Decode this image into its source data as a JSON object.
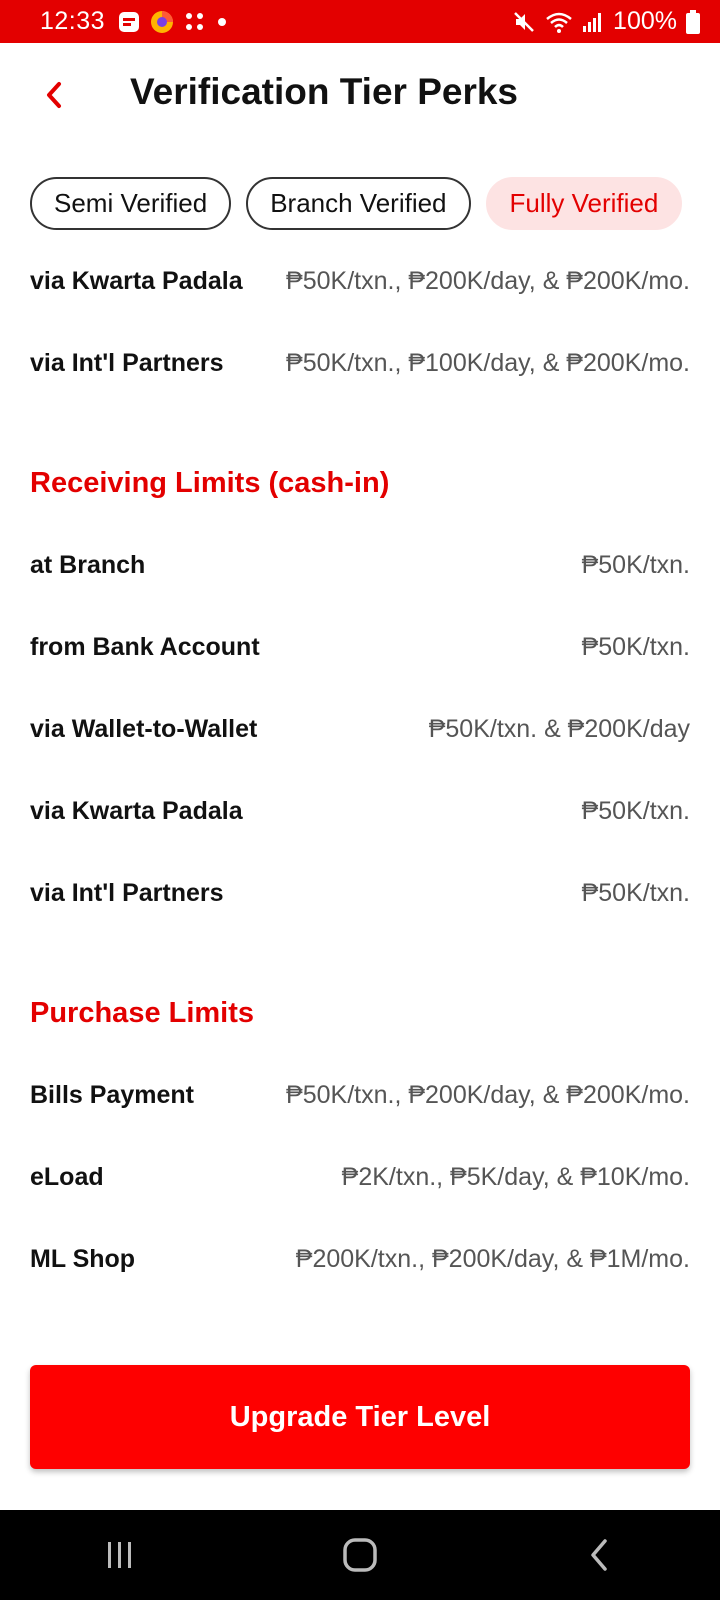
{
  "status_bar": {
    "time": "12:33",
    "battery": "100%",
    "icons": [
      "app-icon",
      "browser-icon",
      "dots-app-icon",
      "dot-icon",
      "mute-icon",
      "wifi-icon",
      "signal-icon",
      "battery-icon"
    ]
  },
  "header": {
    "title": "Verification Tier Perks",
    "back_icon": "chevron-left-icon"
  },
  "tabs": [
    {
      "label": "Semi Verified",
      "active": false
    },
    {
      "label": "Branch Verified",
      "active": false
    },
    {
      "label": "Fully Verified",
      "active": true
    }
  ],
  "sending_rows": [
    {
      "label": "via Kwarta Padala",
      "value": "₱50K/txn., ₱200K/day, & ₱200K/mo."
    },
    {
      "label": "via Int'l Partners",
      "value": "₱50K/txn., ₱100K/day, & ₱200K/mo."
    }
  ],
  "receiving": {
    "title": "Receiving Limits (cash-in)",
    "rows": [
      {
        "label": "at Branch",
        "value": "₱50K/txn."
      },
      {
        "label": "from Bank Account",
        "value": "₱50K/txn."
      },
      {
        "label": "via Wallet-to-Wallet",
        "value": "₱50K/txn. & ₱200K/day"
      },
      {
        "label": "via Kwarta Padala",
        "value": "₱50K/txn."
      },
      {
        "label": "via Int'l Partners",
        "value": "₱50K/txn."
      }
    ]
  },
  "purchase": {
    "title": "Purchase Limits",
    "rows": [
      {
        "label": "Bills Payment",
        "value": "₱50K/txn., ₱200K/day, & ₱200K/mo."
      },
      {
        "label": "eLoad",
        "value": "₱2K/txn., ₱5K/day, & ₱10K/mo."
      },
      {
        "label": "ML Shop",
        "value": "₱200K/txn., ₱200K/day, & ₱1M/mo."
      }
    ]
  },
  "upgrade_button": "Upgrade Tier Level",
  "colors": {
    "accent": "#e30000",
    "button": "#fe0000",
    "tab_active_bg": "#fde3e3"
  },
  "nav_icons": [
    "recent-apps-icon",
    "home-icon",
    "back-icon"
  ]
}
